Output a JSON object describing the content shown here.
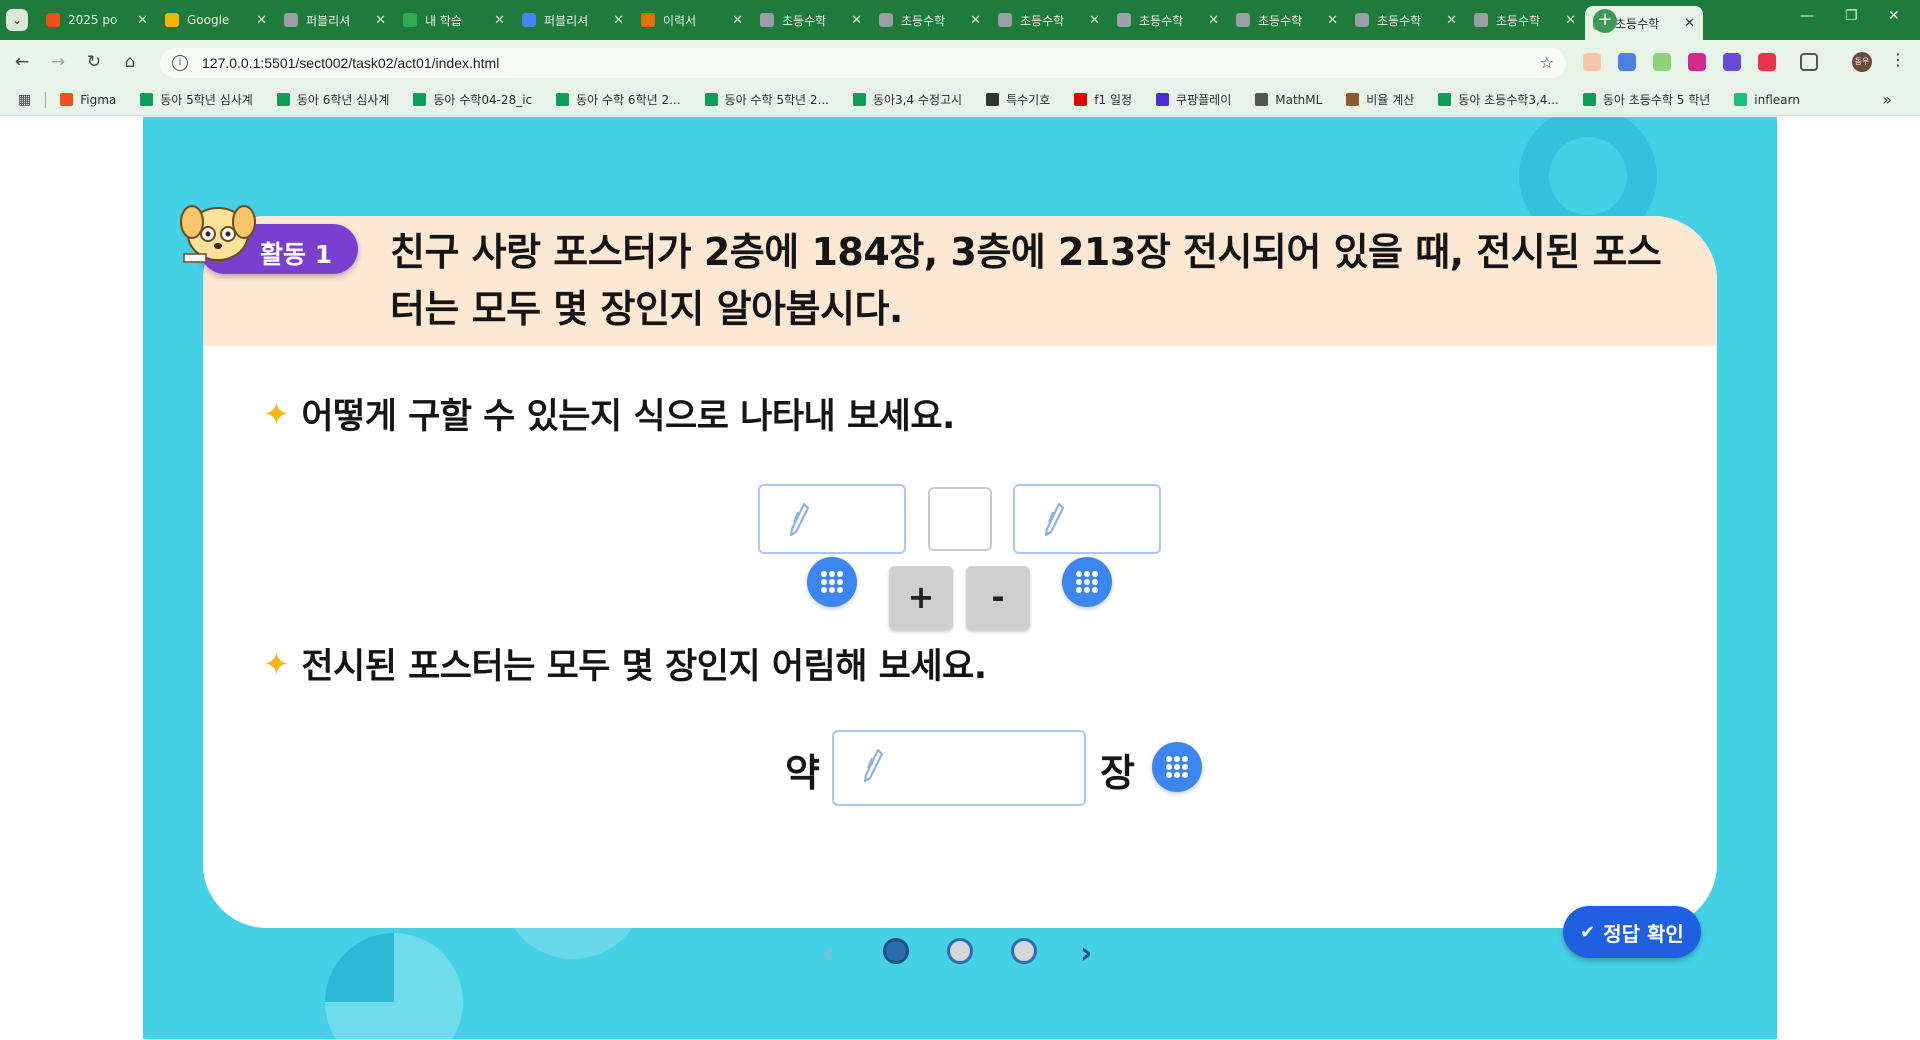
{
  "browser": {
    "tabs": [
      {
        "label": "2025 po",
        "color": "#f24e1e"
      },
      {
        "label": "Google",
        "color": "#f4b400"
      },
      {
        "label": "퍼블리셔",
        "color": "#9aa0a6"
      },
      {
        "label": "내 학습",
        "color": "#34a853"
      },
      {
        "label": "퍼블리셔",
        "color": "#4285f4"
      },
      {
        "label": "이력서",
        "color": "#e8710a"
      },
      {
        "label": "초등수학",
        "color": "#9aa0a6"
      },
      {
        "label": "초등수학",
        "color": "#9aa0a6"
      },
      {
        "label": "초등수학",
        "color": "#9aa0a6"
      },
      {
        "label": "초등수학",
        "color": "#9aa0a6"
      },
      {
        "label": "초등수학",
        "color": "#9aa0a6"
      },
      {
        "label": "초등수학",
        "color": "#9aa0a6"
      },
      {
        "label": "초등수학",
        "color": "#9aa0a6"
      },
      {
        "label": "초등수학",
        "color": "#9aa0a6",
        "active": true
      }
    ],
    "url": "127.0.0.1:5501/sect002/task02/act01/index.html",
    "bookmarks": [
      {
        "label": "Figma",
        "color": "#f24e1e"
      },
      {
        "label": "동아 5학년 심사계",
        "color": "#0f9d58"
      },
      {
        "label": "동아 6학년 심사계",
        "color": "#0f9d58"
      },
      {
        "label": "동아 수학04-28_ic",
        "color": "#0f9d58"
      },
      {
        "label": "동아 수학 6학년 2...",
        "color": "#0f9d58"
      },
      {
        "label": "동아 수학 5학년 2...",
        "color": "#0f9d58"
      },
      {
        "label": "동아3,4 수정고시",
        "color": "#0f9d58"
      },
      {
        "label": "특수기호",
        "color": "#333333"
      },
      {
        "label": "f1 일정",
        "color": "#e10600"
      },
      {
        "label": "쿠팡플레이",
        "color": "#4b2bd6"
      },
      {
        "label": "MathML",
        "color": "#555555"
      },
      {
        "label": "비율 계산",
        "color": "#8a5a2b"
      },
      {
        "label": "동아 초등수학3,4...",
        "color": "#0f9d58"
      },
      {
        "label": "동아 초등수학 5 학년",
        "color": "#0f9d58"
      },
      {
        "label": "inflearn",
        "color": "#1dc078"
      }
    ]
  },
  "activity": {
    "badge": "활동 1",
    "question": "친구 사랑 포스터가 2층에 184장, 3층에 213장 전시되어 있을 때, 전시된 포스터는 모두 몇 장인지 알아봅시다."
  },
  "step1": {
    "text": "어떻게 구할 수 있는지 식으로 나타내 보세요."
  },
  "operators": {
    "plus": "+",
    "minus": "-"
  },
  "step2": {
    "text": "전시된 포스터는 모두 몇 장인지 어림해 보세요."
  },
  "estimate": {
    "prefix": "약",
    "suffix": "장"
  },
  "check_button": "정답 확인",
  "pager": {
    "pages": 3,
    "current": 1
  }
}
